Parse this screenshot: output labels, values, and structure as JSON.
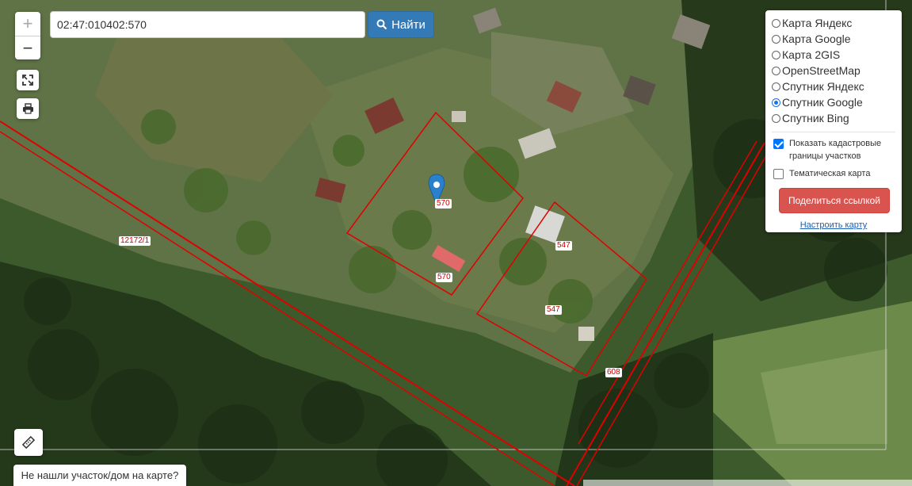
{
  "search": {
    "value": "02:47:010402:570",
    "button_label": "Найти",
    "button_icon": "search-icon"
  },
  "zoom": {
    "in": "+",
    "out": "−"
  },
  "tools": {
    "fullscreen_icon": "expand-icon",
    "print_icon": "print-icon",
    "ruler_icon": "ruler-icon"
  },
  "layers": {
    "options": [
      {
        "label": "Карта Яндекс",
        "selected": false
      },
      {
        "label": "Карта Google",
        "selected": false
      },
      {
        "label": "Карта 2GIS",
        "selected": false
      },
      {
        "label": "OpenStreetMap",
        "selected": false
      },
      {
        "label": "Спутник Яндекс",
        "selected": false
      },
      {
        "label": "Спутник Google",
        "selected": true
      },
      {
        "label": "Спутник Bing",
        "selected": false
      }
    ],
    "show_cadastral_label": "Показать кадастровые границы участков",
    "show_cadastral_checked": true,
    "thematic_label": "Тематическая карта",
    "thematic_checked": false,
    "share_label": "Поделиться ссылкой",
    "config_label": "Настроить карту"
  },
  "parcel_labels": [
    "570",
    "570",
    "547",
    "547",
    "608",
    "12172/1"
  ],
  "not_found_label": "Не нашли участок/дом на карте?",
  "colors": {
    "accent_blue": "#337ab7",
    "share_red": "#d9534f",
    "boundary_red": "#e00000",
    "marker": "#2a81cb"
  }
}
